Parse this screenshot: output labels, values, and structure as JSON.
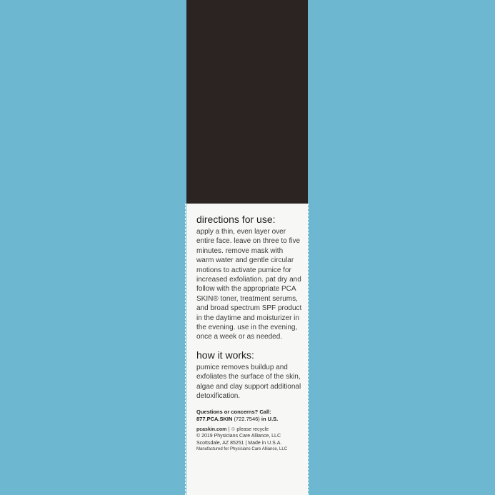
{
  "directions": {
    "heading": "directions for use:",
    "text": "apply a thin, even layer over entire face. leave on three to five minutes. remove mask with warm water and gentle circular motions to activate pumice for increased exfoliation. pat dry and follow with the appropriate PCA SKIN® toner, treatment serums, and broad spectrum SPF product in the daytime and moisturizer in the evening. use in the evening, once a week or as needed."
  },
  "how_it_works": {
    "heading": "how it works:",
    "text": "pumice removes buildup and exfoliates the surface of the skin, algae and clay support additional detoxification."
  },
  "contact": {
    "question": "Questions or concerns? Call:",
    "phone_word": "877.PCA.SKIN",
    "phone_digits": "(722.7546)",
    "suffix": "in U.S."
  },
  "footer": {
    "website": "pcaskin.com",
    "separator": "|",
    "recycle_text": "please recycle",
    "copyright": "© 2019 Physicians Care Alliance, LLC",
    "address": "Scottsdale, AZ 85251",
    "made_in": "Made in U.S.A.",
    "manufactured": "Manufactured for Physicians Care Alliance, LLC"
  },
  "colors": {
    "background": "#6db8d0",
    "band": "#2b2423",
    "panel": "#f7f7f5"
  }
}
